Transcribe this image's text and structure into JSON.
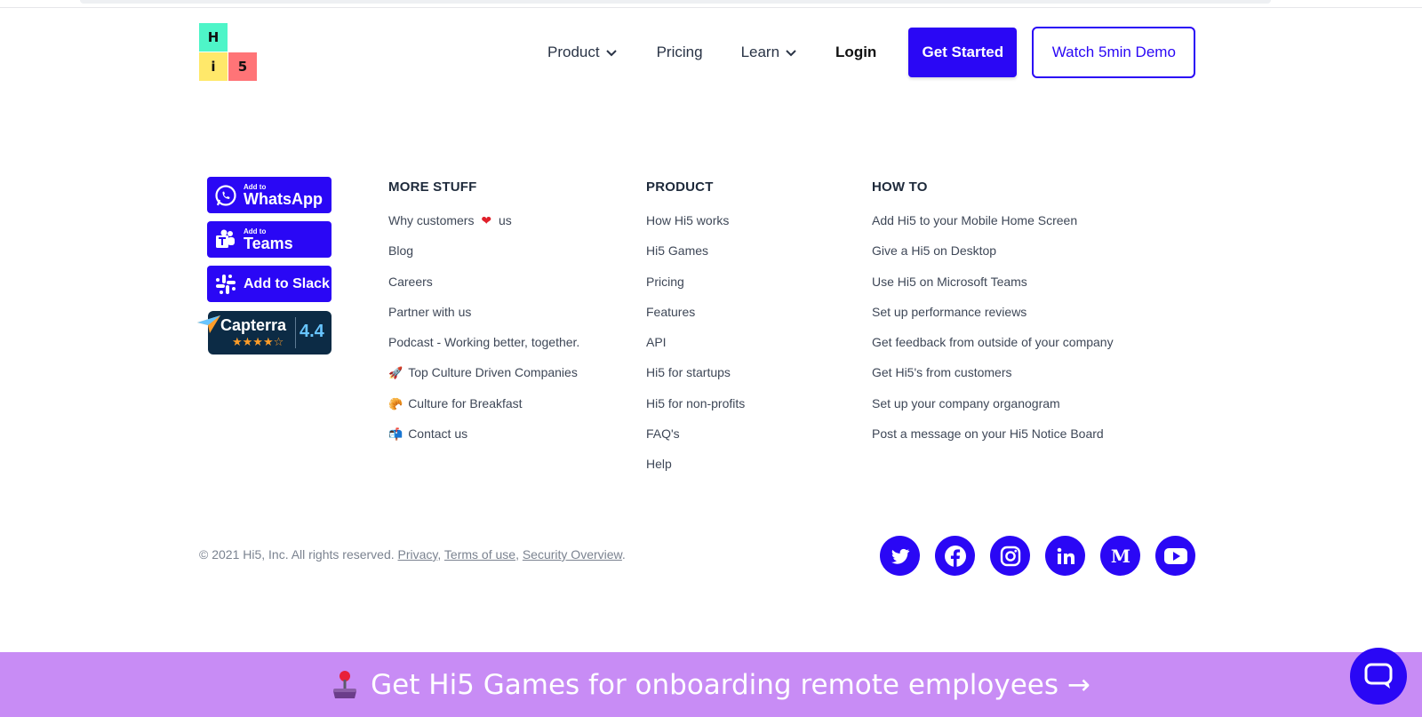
{
  "logo": {
    "h": "H",
    "i": "i",
    "five": "5"
  },
  "nav": {
    "product": "Product",
    "pricing": "Pricing",
    "learn": "Learn",
    "login": "Login",
    "get_started": "Get Started",
    "watch_demo": "Watch 5min Demo"
  },
  "badges": {
    "whatsapp": {
      "small": "Add to",
      "big": "WhatsApp"
    },
    "teams": {
      "small": "Add to",
      "big": "Teams"
    },
    "slack": {
      "label": "Add to Slack"
    },
    "capterra": {
      "name": "Capterra",
      "stars": "★★★★☆",
      "score": "4.4"
    }
  },
  "columns": {
    "more": {
      "title": "MORE STUFF",
      "items": [
        "Why customers",
        "us",
        "Blog",
        "Careers",
        "Partner with us",
        "Podcast - Working better, together.",
        "Top Culture Driven Companies",
        "Culture for Breakfast",
        "Contact us"
      ]
    },
    "product": {
      "title": "PRODUCT",
      "items": [
        "How Hi5 works",
        "Hi5 Games",
        "Pricing",
        "Features",
        "API",
        "Hi5 for startups",
        "Hi5 for non-profits",
        "FAQ's",
        "Help"
      ]
    },
    "howto": {
      "title": "HOW TO",
      "items": [
        "Add Hi5 to your Mobile Home Screen",
        "Give a Hi5 on Desktop",
        "Use Hi5 on Microsoft Teams",
        "Set up performance reviews",
        "Get feedback from outside of your company",
        "Get Hi5's from customers",
        "Set up your company organogram",
        "Post a message on your Hi5 Notice Board"
      ]
    }
  },
  "footer": {
    "copyright": "© 2021 Hi5, Inc. All rights reserved.",
    "privacy": "Privacy",
    "terms": "Terms of use",
    "security": "Security Overview"
  },
  "social": [
    "twitter-icon",
    "facebook-icon",
    "instagram-icon",
    "linkedin-icon",
    "medium-icon",
    "youtube-icon"
  ],
  "banner": {
    "text": "Get Hi5 Games for onboarding remote employees →"
  },
  "colors": {
    "brand": "#2a07f5",
    "banner": "#c88cf5"
  }
}
